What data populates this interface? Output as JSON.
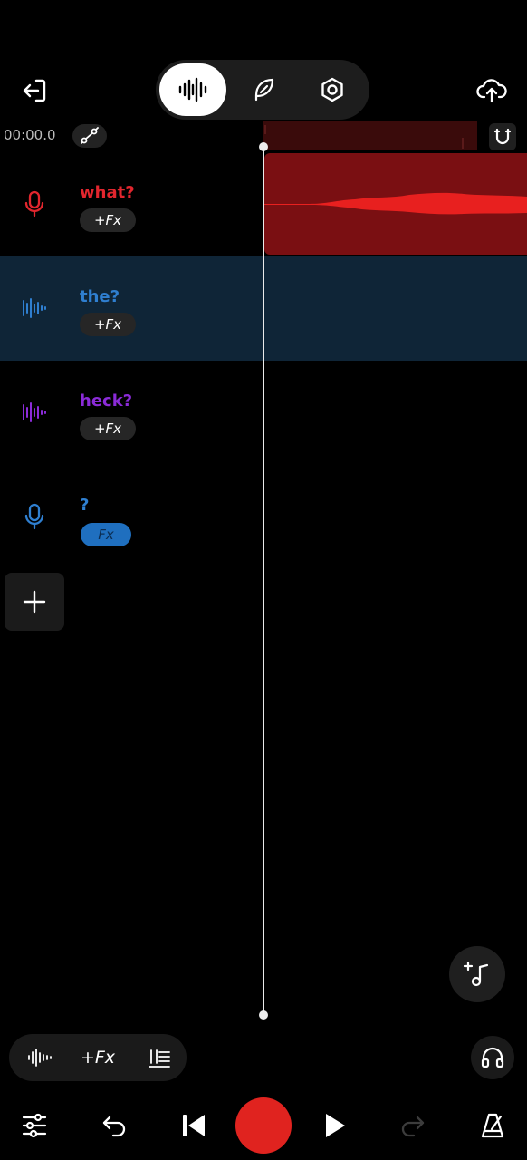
{
  "header": {
    "icons": {
      "back": "exit-arrow-icon",
      "record_mode": "waveform-icon",
      "edit_mode": "feather-icon",
      "settings": "hex-nut-icon",
      "upload": "cloud-upload-icon"
    }
  },
  "timeline": {
    "time": "00:00.0",
    "icons": {
      "automation": "node-curve-icon",
      "snap": "magnet-icon"
    }
  },
  "tracks": [
    {
      "name": "what?",
      "fx_label": "+Fx",
      "icon": "microphone-icon",
      "color": "#e2262e",
      "selected": false
    },
    {
      "name": "the?",
      "fx_label": "+Fx",
      "icon": "waveform-icon",
      "color": "#2f7fd0",
      "selected": true
    },
    {
      "name": "heck?",
      "fx_label": "+Fx",
      "icon": "waveform-icon",
      "color": "#8b2bd8",
      "selected": false
    },
    {
      "name": "?",
      "fx_label": "Fx",
      "icon": "microphone-icon",
      "color": "#2f7fd0",
      "selected": false
    }
  ],
  "toolbar": {
    "fx_label": "+Fx",
    "icons": {
      "waveform": "waveform-icon",
      "mixer": "mixer-list-icon",
      "add_music": "add-music-icon",
      "headphones": "headphones-icon",
      "sliders": "sliders-icon",
      "undo": "undo-icon",
      "skip_back": "skip-back-icon",
      "record": "record-icon",
      "play": "play-icon",
      "redo": "redo-icon",
      "metronome": "metronome-icon"
    }
  },
  "colors": {
    "background": "#000000",
    "clip_red": "#7a0f12",
    "waveform_red": "#e8201f",
    "record_red": "#e0231f",
    "selected_track": "#0f2537"
  }
}
